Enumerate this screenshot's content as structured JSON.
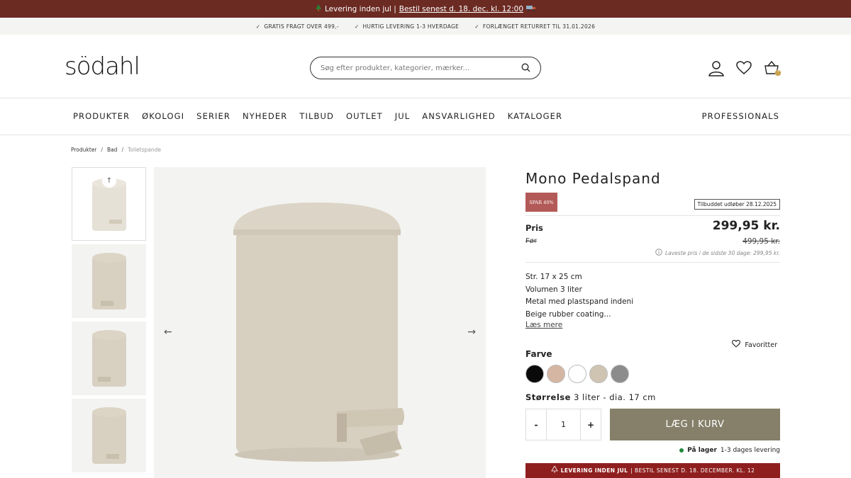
{
  "topbar": {
    "icon": "christmas-tree-icon",
    "prefix": "Levering inden jul |",
    "link": "Bestil senest d. 18. dec. kl. 12:00",
    "truck_icon": "truck-icon"
  },
  "usps": [
    "GRATIS FRAGT OVER 499,-",
    "HURTIG LEVERING 1-3 HVERDAGE",
    "FORLÆNGET RETURRET TIL 31.01.2026"
  ],
  "header": {
    "logo": "södahl",
    "search_placeholder": "Søg efter produkter, kategorier, mærker...",
    "cart_count": "0"
  },
  "nav": {
    "items": [
      "PRODUKTER",
      "ØKOLOGI",
      "SERIER",
      "NYHEDER",
      "TILBUD",
      "OUTLET",
      "JUL",
      "ANSVARLIGHED",
      "KATALOGER"
    ],
    "professionals": "PROFESSIONALS"
  },
  "breadcrumb": [
    "Produkter",
    "Bad",
    "Toiletspande"
  ],
  "product": {
    "title": "Mono Pedalspand",
    "badge": "SPAR 40%",
    "offer_expires": "Tilbuddet udløber 28.12.2025",
    "price_label": "Pris",
    "price": "299,95 kr.",
    "before_label": "Før",
    "before_price": "499,95 kr.",
    "lowest_price_note": "Laveste pris i de sidste 30 dage: 299,95 kr.",
    "description": [
      "Str. 17 x 25 cm",
      "Volumen 3 liter",
      "Metal med plastspand indeni",
      "Beige rubber coating..."
    ],
    "read_more": "Læs mere",
    "color_label": "Farve",
    "favorites_label": "Favoritter",
    "colors": [
      "#0a0a0a",
      "#d4b6a2",
      "#ffffff",
      "#cfc4b2",
      "#8c8c8c"
    ],
    "size_label": "Størrelse",
    "size_value": "3 liter - dia. 17 cm",
    "qty_minus": "-",
    "qty_value": "1",
    "qty_plus": "+",
    "add_to_cart": "LÆG I KURV",
    "stock_label": "På lager",
    "stock_note": "1-3 dages levering",
    "xmas_banner": "LEVERING INDEN JUL",
    "xmas_banner_rest": "| BESTIL SENEST D. 18. DECEMBER. KL. 12"
  },
  "colors": {
    "topbar_bg": "#6b2a22",
    "cart_button": "#86806a",
    "badge": "#b35a58",
    "xmas_banner": "#8f1f1f",
    "product_beige": "#d7d0c1"
  }
}
